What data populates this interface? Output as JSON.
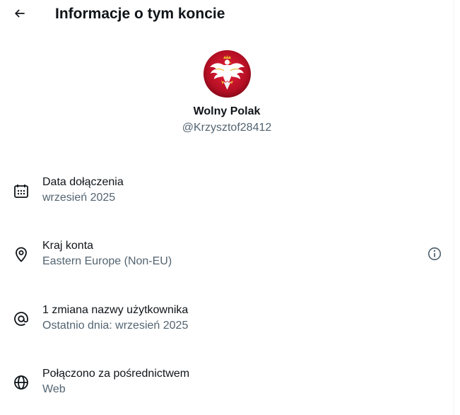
{
  "header": {
    "title": "Informacje o tym koncie",
    "back_icon": "arrow-left-icon"
  },
  "profile": {
    "avatar_icon": "polish-eagle-avatar",
    "display_name": "Wolny Polak",
    "handle": "@Krzysztof28412"
  },
  "details": [
    {
      "icon": "calendar-icon",
      "label": "Data dołączenia",
      "value": "wrzesień 2025"
    },
    {
      "icon": "location-pin-icon",
      "label": "Kraj konta",
      "value": "Eastern Europe (Non-EU)",
      "info_icon": "info-icon"
    },
    {
      "icon": "at-sign-icon",
      "label": "1 zmiana nazwy użytkownika",
      "value": "Ostatnio dnia: wrzesień 2025"
    },
    {
      "icon": "globe-icon",
      "label": "Połączono za pośrednictwem",
      "value": "Web"
    }
  ],
  "colors": {
    "text_primary": "#0f1419",
    "text_secondary": "#536471",
    "avatar_red": "#c8102e",
    "border": "#eff3f4"
  }
}
